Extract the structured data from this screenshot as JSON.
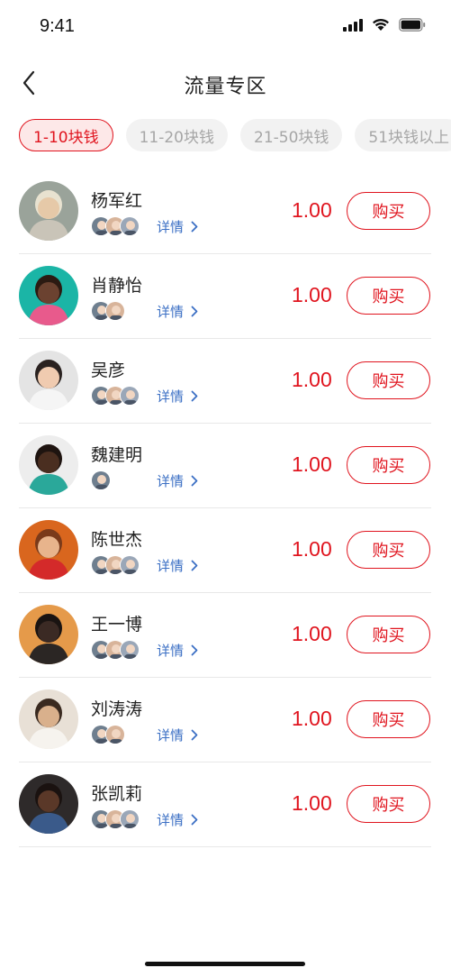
{
  "status": {
    "time": "9:41"
  },
  "header": {
    "title": "流量专区"
  },
  "tabs": [
    {
      "label": "1-10块钱",
      "active": true
    },
    {
      "label": "11-20块钱",
      "active": false
    },
    {
      "label": "21-50块钱",
      "active": false
    },
    {
      "label": "51块钱以上",
      "active": false
    }
  ],
  "list": {
    "detail_label": "详情",
    "buy_label": "购买",
    "items": [
      {
        "name": "杨军红",
        "price": "1.00",
        "mini_count": 3
      },
      {
        "name": "肖静怡",
        "price": "1.00",
        "mini_count": 2
      },
      {
        "name": "吴彦",
        "price": "1.00",
        "mini_count": 3
      },
      {
        "name": "魏建明",
        "price": "1.00",
        "mini_count": 1
      },
      {
        "name": "陈世杰",
        "price": "1.00",
        "mini_count": 3
      },
      {
        "name": "王一博",
        "price": "1.00",
        "mini_count": 3
      },
      {
        "name": "刘涛涛",
        "price": "1.00",
        "mini_count": 2
      },
      {
        "name": "张凯莉",
        "price": "1.00",
        "mini_count": 3
      }
    ]
  },
  "colors": {
    "accent": "#e0141e",
    "link": "#3b6fc4",
    "tab_inactive_bg": "#f2f2f2"
  }
}
